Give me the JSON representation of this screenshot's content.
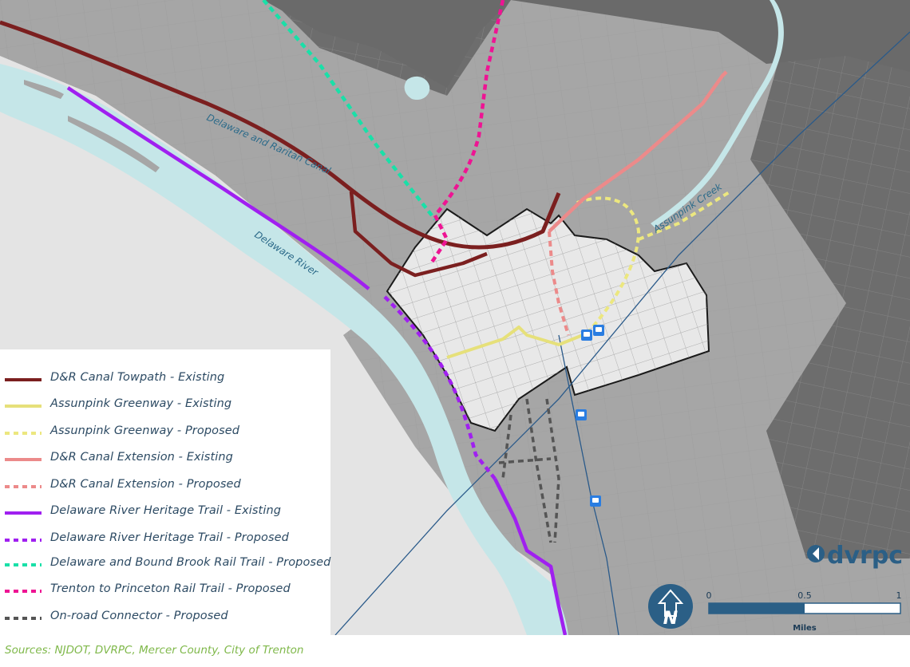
{
  "legend": {
    "items": [
      {
        "label": "D&R Canal Towpath - Existing",
        "color": "#7b1f1f",
        "style": "solid"
      },
      {
        "label": "Assunpink Greenway - Existing",
        "color": "#e6e07a",
        "style": "solid"
      },
      {
        "label": "Assunpink Greenway - Proposed",
        "color": "#ece77f",
        "style": "dashed"
      },
      {
        "label": "D&R Canal Extension - Existing",
        "color": "#ec8a8a",
        "style": "solid"
      },
      {
        "label": "D&R Canal Extension - Proposed",
        "color": "#ec8a8a",
        "style": "dashed"
      },
      {
        "label": "Delaware River Heritage Trail - Existing",
        "color": "#a020f0",
        "style": "solid"
      },
      {
        "label": "Delaware River Heritage Trail - Proposed",
        "color": "#a020f0",
        "style": "dashed"
      },
      {
        "label": "Delaware and Bound Brook Rail Trail - Proposed",
        "color": "#19e0a8",
        "style": "dashed"
      },
      {
        "label": "Trenton to Princeton Rail Trail - Proposed",
        "color": "#ee1493",
        "style": "dashed"
      },
      {
        "label": "On-road Connector - Proposed",
        "color": "#555555",
        "style": "dashed"
      }
    ]
  },
  "labels": {
    "canal": "Delaware and Raritan Canal",
    "river": "Delaware River",
    "creek": "Assunpink Creek"
  },
  "scale": {
    "tick_0": "0",
    "tick_mid": "0.5",
    "tick_end": "1",
    "unit": "Miles"
  },
  "logo": {
    "text": "dvrpc"
  },
  "sources": "Sources: NJDOT, DVRPC, Mercer County, City of Trenton",
  "icons": {
    "north": "north-arrow-icon",
    "train": "train-station-icon"
  }
}
